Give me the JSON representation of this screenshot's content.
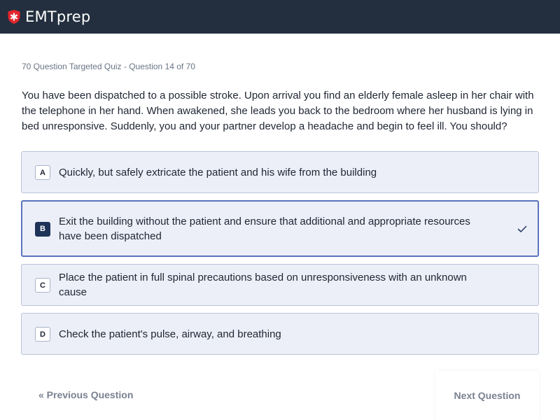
{
  "app": {
    "logo_text": "EMTprep",
    "logo_icon": "shield-cross-icon"
  },
  "quiz": {
    "breadcrumb": "70 Question Targeted Quiz - Question 14 of 70",
    "question": "You have been dispatched to a possible stroke. Upon arrival you find an elderly female asleep in her chair with the telephone in her hand. When awakened, she leads you back to the bedroom where her husband is lying in bed unresponsive. Suddenly, you and your partner develop a headache and begin to feel ill. You should?",
    "answers": [
      {
        "letter": "A",
        "text": "Quickly, but safely extricate the patient and his wife from the building",
        "selected": false
      },
      {
        "letter": "B",
        "text": "Exit the building without the patient and ensure that additional and appropriate resources have been dispatched",
        "selected": true
      },
      {
        "letter": "C",
        "text": "Place the patient in full spinal precautions based on unresponsiveness with an unknown cause",
        "selected": false
      },
      {
        "letter": "D",
        "text": "Check the patient's pulse, airway, and breathing",
        "selected": false
      }
    ]
  },
  "nav": {
    "previous_label": "« Previous Question",
    "next_label": "Next Question"
  },
  "colors": {
    "header_bg": "#232f3e",
    "brand_red": "#e3262e",
    "selected_border": "#5a72bf",
    "answer_bg": "#eceff8"
  }
}
